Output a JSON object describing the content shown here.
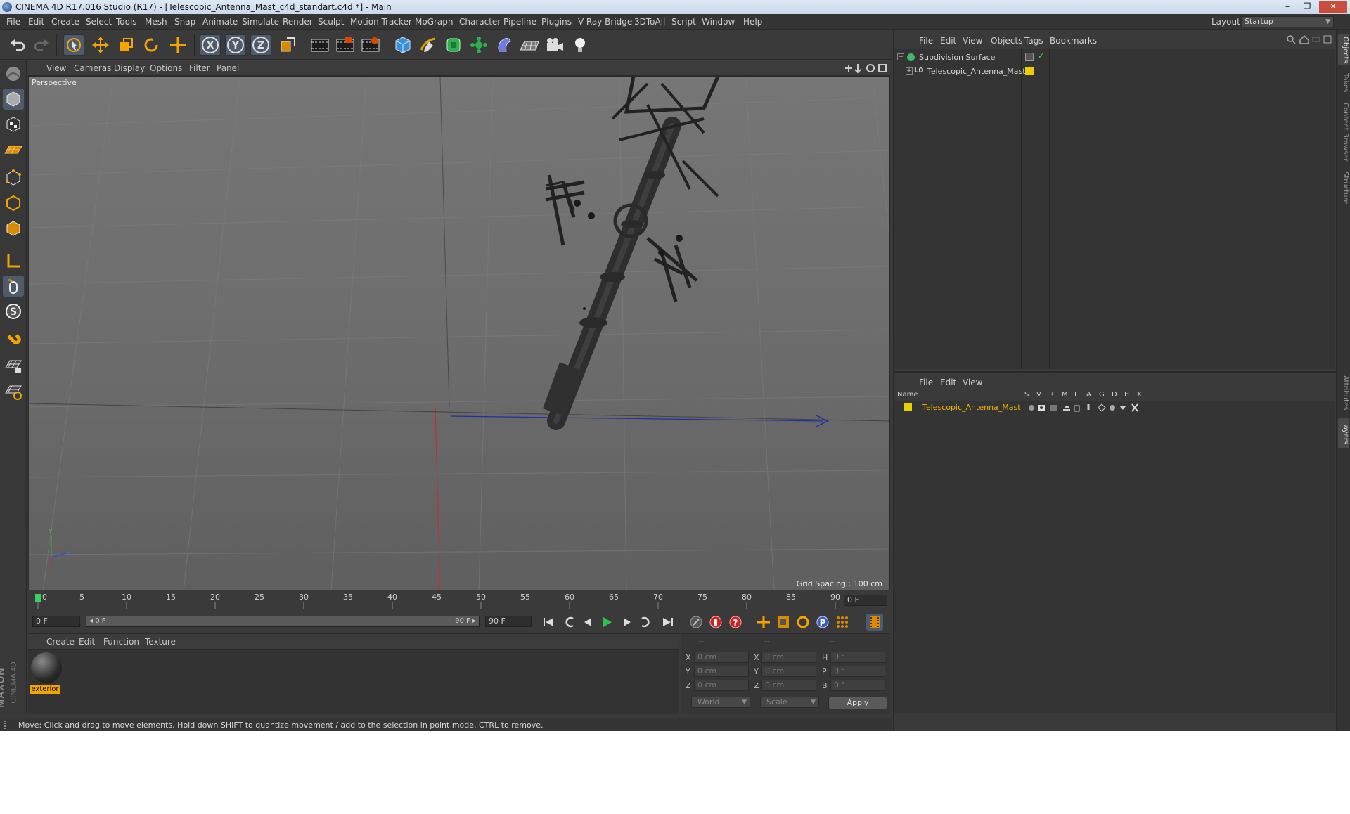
{
  "window": {
    "title": "CINEMA 4D R17.016 Studio (R17) - [Telescopic_Antenna_Mast_c4d_standart.c4d *] - Main",
    "controls": [
      "–",
      "❐",
      "✕"
    ]
  },
  "menubar": {
    "items": [
      "File",
      "Edit",
      "Create",
      "Select",
      "Tools",
      "Mesh",
      "Snap",
      "Animate",
      "Simulate",
      "Render",
      "Sculpt",
      "Motion Tracker",
      "MoGraph",
      "Character",
      "Pipeline",
      "Plugins",
      "V-Ray Bridge",
      "3DToAll",
      "Script",
      "Window",
      "Help"
    ],
    "layout_label": "Layout:",
    "layout_value": "Startup"
  },
  "toolbar": {
    "icons": [
      "undo-icon",
      "redo-icon",
      "select-pointer-icon",
      "move-icon",
      "scale-icon",
      "rotate-icon",
      "live-move-icon",
      "x-axis-icon",
      "y-axis-icon",
      "z-axis-icon",
      "coordinate-system-icon",
      "render-view-icon",
      "render-picture-viewer-icon",
      "edit-render-settings-icon",
      "cube-icon",
      "pen-spline-icon",
      "subdivision-icon",
      "array-icon",
      "deformer-icon",
      "floor-icon",
      "camera-icon",
      "light-icon"
    ],
    "axis_labels": [
      "X",
      "Y",
      "Z"
    ]
  },
  "left_tools": [
    "make-editable-icon",
    "model-mode-icon",
    "texture-mode-icon",
    "workplane-mode-icon",
    "points-mode-icon",
    "edges-mode-icon",
    "polygons-mode-icon",
    "axis-mode-icon",
    "tweak-mode-icon",
    "solo-mode-icon",
    "magnet-icon",
    "snap-icon",
    "locked-workplane-icon"
  ],
  "viewport": {
    "menus": [
      "View",
      "Cameras",
      "Display",
      "Options",
      "Filter",
      "Panel"
    ],
    "camera_label": "Perspective",
    "grid_spacing": "Grid Spacing : 100 cm",
    "axis_gizmo": {
      "y": "Y",
      "z": "Z"
    }
  },
  "timeline": {
    "ticks": [
      "0",
      "5",
      "10",
      "15",
      "20",
      "25",
      "30",
      "35",
      "40",
      "45",
      "50",
      "55",
      "60",
      "65",
      "70",
      "75",
      "80",
      "85",
      "90"
    ],
    "current_frame_display": "0 F",
    "start_field": "0 F",
    "range_start": "◂ 0 F",
    "range_end": "90 F ▸",
    "end_field": "90 F"
  },
  "material_manager": {
    "menus": [
      "Create",
      "Edit",
      "Function",
      "Texture"
    ],
    "materials": [
      {
        "name": "exterior"
      }
    ],
    "brand_line1": "MAXON",
    "brand_line2": "CINEMA 4D"
  },
  "coordinates": {
    "headers": [
      "--",
      "--",
      "--"
    ],
    "rows": [
      {
        "a": "X",
        "av": "0 cm",
        "b": "X",
        "bv": "0 cm",
        "c": "H",
        "cv": "0 °"
      },
      {
        "a": "Y",
        "av": "0 cm",
        "b": "Y",
        "bv": "0 cm",
        "c": "P",
        "cv": "0 °"
      },
      {
        "a": "Z",
        "av": "0 cm",
        "b": "Z",
        "bv": "0 cm",
        "c": "B",
        "cv": "0 °"
      }
    ],
    "space_select": "World",
    "mode_select": "Scale",
    "apply_label": "Apply"
  },
  "status": {
    "text": "Move: Click and drag to move elements. Hold down SHIFT to quantize movement / add to the selection in point mode, CTRL to remove."
  },
  "object_manager": {
    "menus": [
      "File",
      "Edit",
      "View",
      "Objects",
      "Tags",
      "Bookmarks"
    ],
    "objects": [
      {
        "name": "Subdivision Surface",
        "color": "#3fb86a"
      },
      {
        "name": "Telescopic_Antenna_Mast",
        "color": "#e8d000"
      }
    ]
  },
  "layer_manager": {
    "menus": [
      "File",
      "Edit",
      "View"
    ],
    "columns": [
      "Name",
      "S",
      "V",
      "R",
      "M",
      "L",
      "A",
      "G",
      "D",
      "E",
      "X"
    ],
    "layers": [
      {
        "name": "Telescopic_Antenna_Mast",
        "color": "#e8d000"
      }
    ]
  },
  "side_tabs": [
    "Objects",
    "Takes",
    "Content Browser",
    "Structure",
    "Attributes",
    "Layers"
  ],
  "colors": {
    "accent_orange": "#f2a400",
    "selection_blue": "#4f5a6a",
    "layer_name_color": "#f2b400",
    "play_green": "#2fc24a",
    "record_red": "#d02020"
  }
}
